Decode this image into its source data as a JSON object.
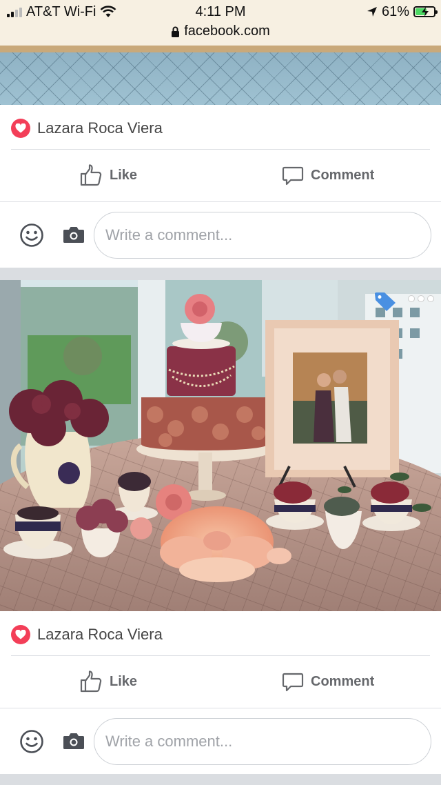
{
  "status_bar": {
    "carrier": "AT&T Wi-Fi",
    "time": "4:11 PM",
    "battery_percent": "61%",
    "battery_level": 0.61,
    "url": "facebook.com",
    "icons": [
      "signal-icon",
      "wifi-icon",
      "location-icon",
      "battery-icon",
      "lock-icon"
    ]
  },
  "posts": [
    {
      "reaction_name": "Lazara Roca Viera",
      "like_label": "Like",
      "comment_label": "Comment",
      "comment_placeholder": "Write a comment..."
    },
    {
      "reaction_name": "Lazara Roca Viera",
      "like_label": "Like",
      "comment_label": "Comment",
      "comment_placeholder": "Write a comment..."
    }
  ],
  "colors": {
    "status_bg": "#f7f0e2",
    "reaction_heart": "#f33e58",
    "action_text": "#65676b",
    "tag_blue": "#4a90e2"
  }
}
